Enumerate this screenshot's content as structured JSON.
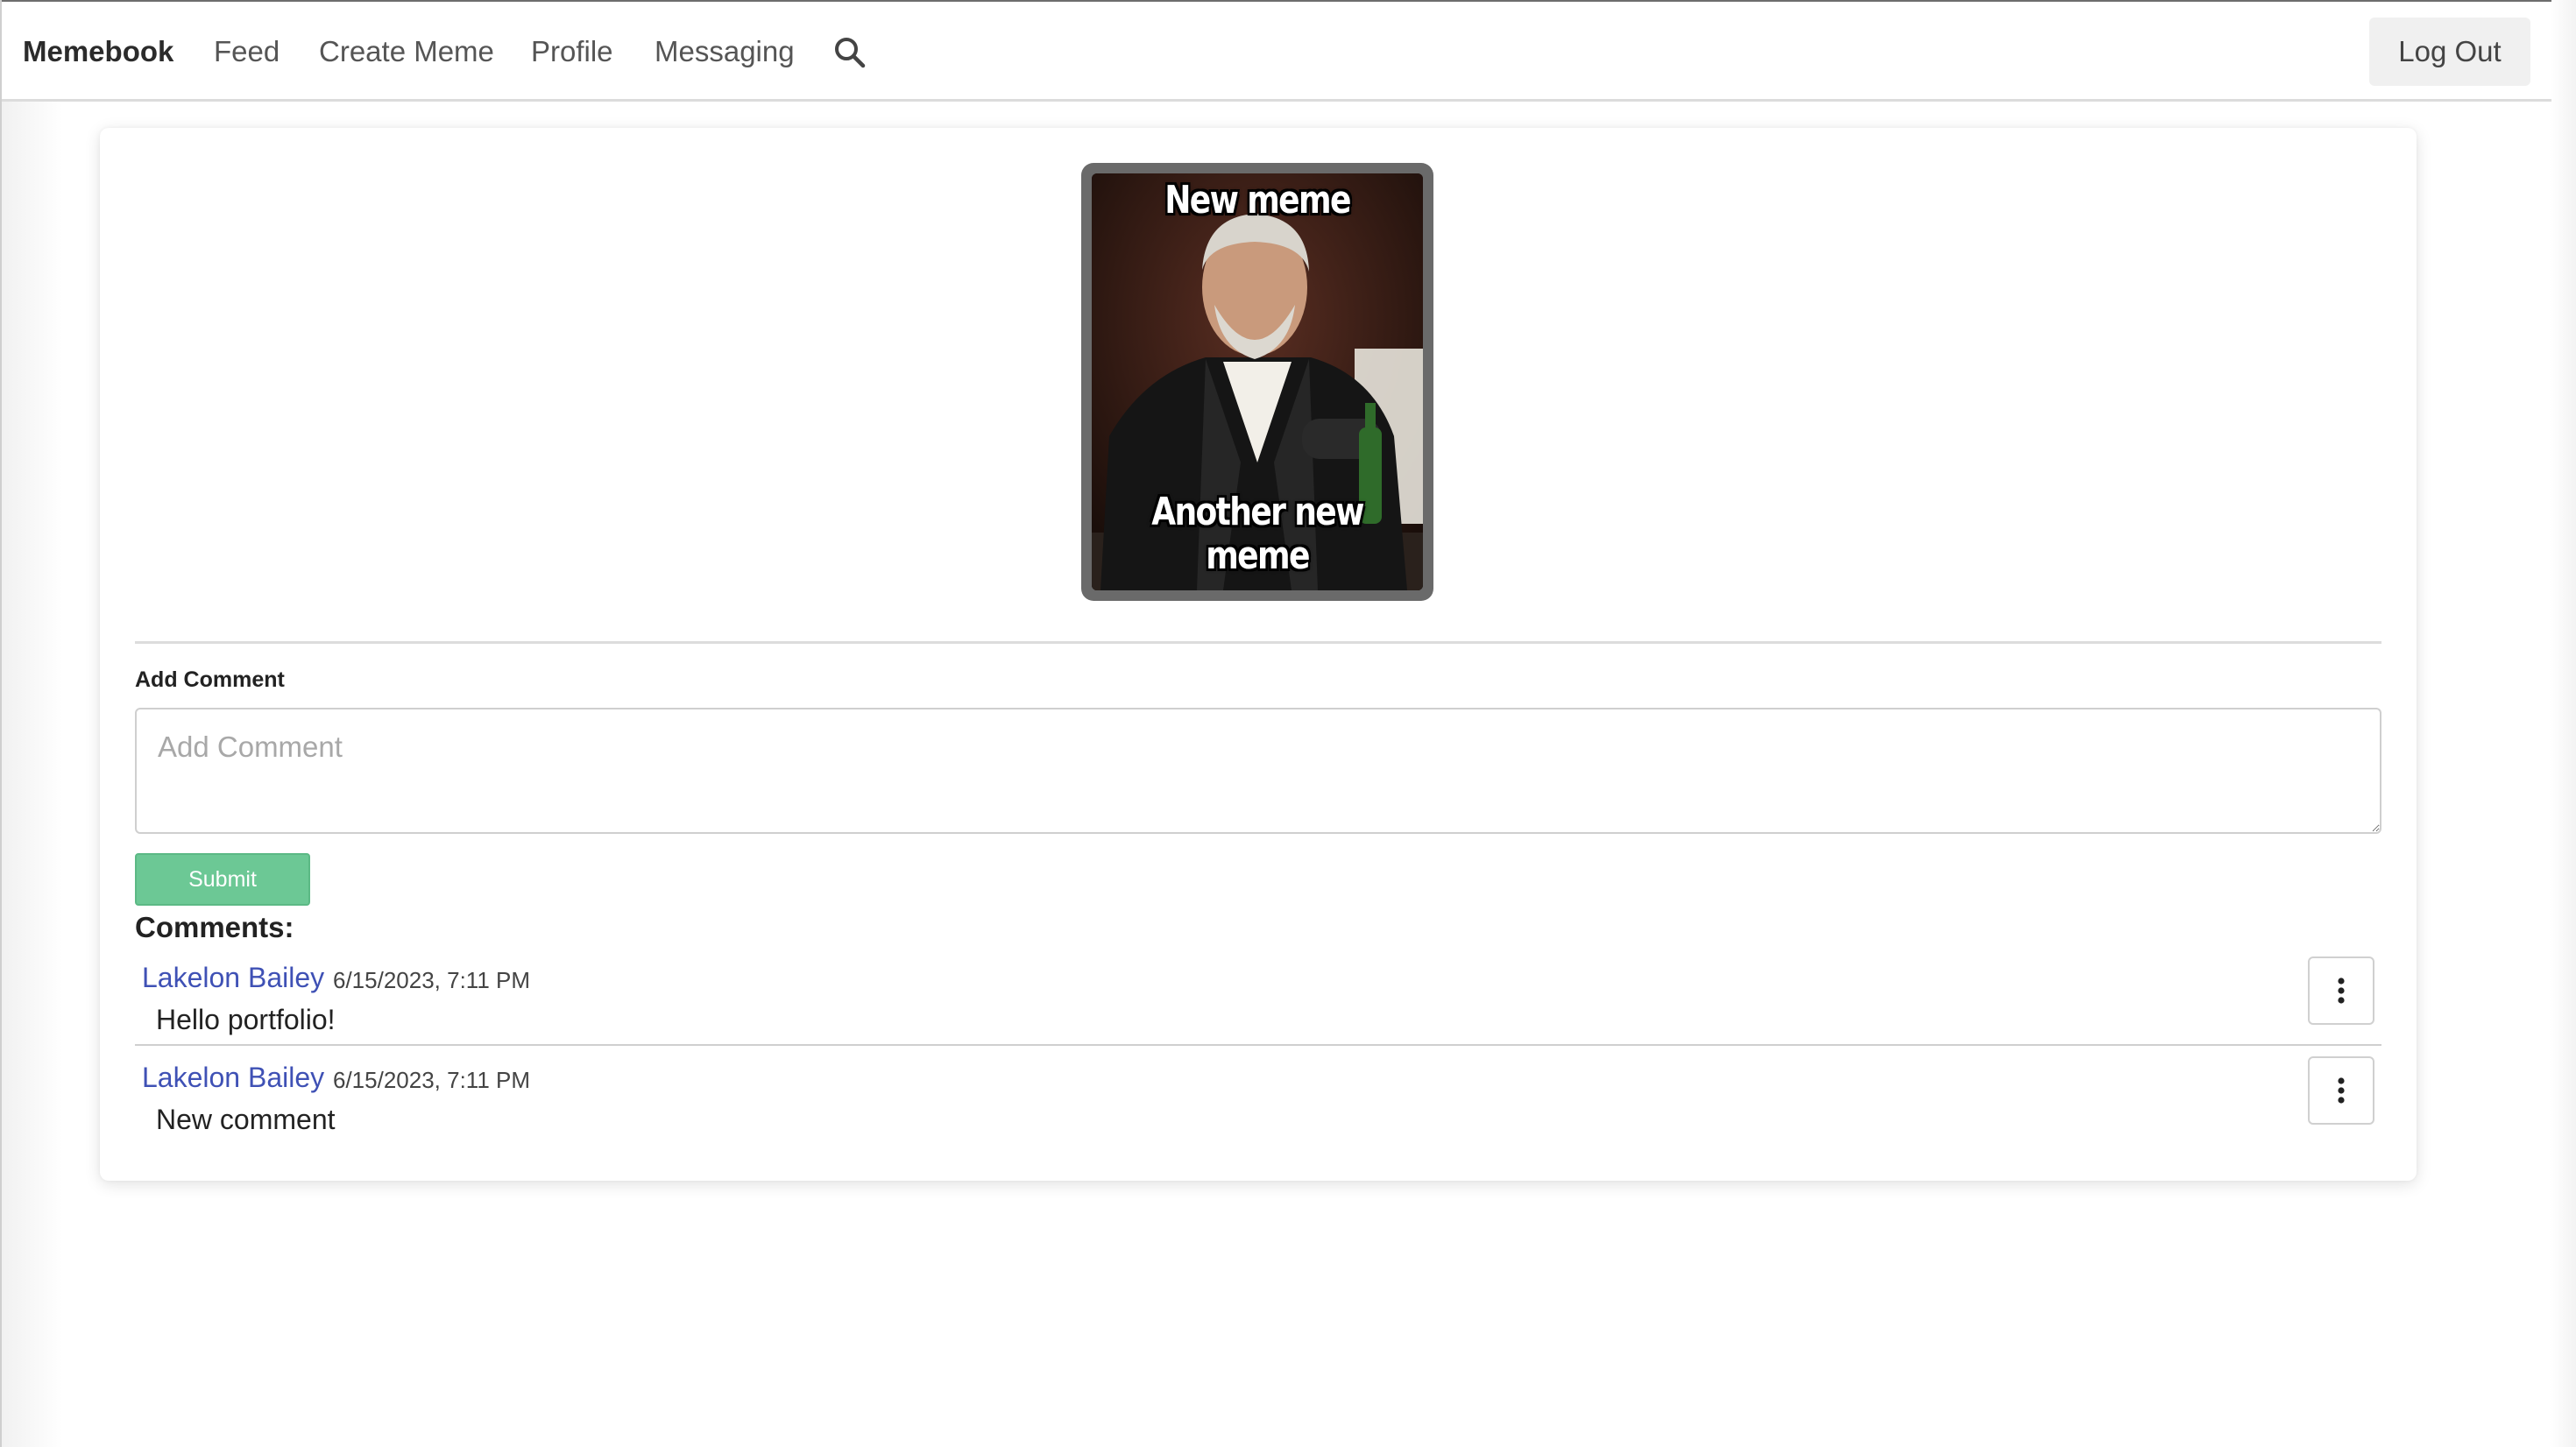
{
  "navbar": {
    "brand": "Memebook",
    "links": [
      "Feed",
      "Create Meme",
      "Profile",
      "Messaging"
    ],
    "search_icon": "search-icon",
    "logout_label": "Log Out"
  },
  "meme": {
    "top_text": "New meme",
    "bottom_text": "Another new meme"
  },
  "comment_form": {
    "label": "Add Comment",
    "placeholder": "Add Comment",
    "value": "",
    "submit_label": "Submit"
  },
  "comments": {
    "heading": "Comments:",
    "items": [
      {
        "author": "Lakelon Bailey",
        "date": "6/15/2023, 7:11 PM",
        "text": "Hello portfolio!",
        "menu_icon": "kebab-menu-icon"
      },
      {
        "author": "Lakelon Bailey",
        "date": "6/15/2023, 7:11 PM",
        "text": "New comment",
        "menu_icon": "kebab-menu-icon"
      }
    ]
  },
  "colors": {
    "author_link": "#3f51b5",
    "submit_bg": "#6cc895",
    "logout_bg": "#f0f0f0"
  }
}
